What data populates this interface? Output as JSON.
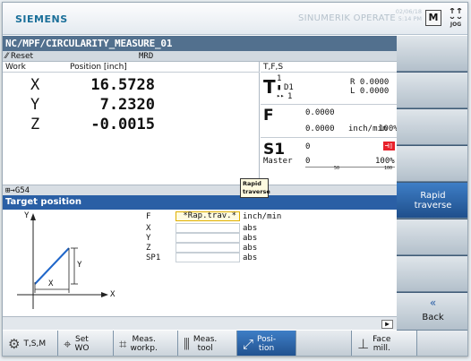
{
  "header": {
    "logo": "SIEMENS",
    "brand": "SINUMERIK OPERATE",
    "date": "02/06/18",
    "time": "5:14 PM",
    "m_label": "M",
    "jog_label": "JOG"
  },
  "path": "NC/MPF/CIRCULARITY_MEASURE_01",
  "status": {
    "reset": "Reset",
    "mrd": "MRD"
  },
  "position": {
    "col_work": "Work",
    "col_pos": "Position [inch]",
    "axes": [
      {
        "name": "X",
        "value": "16.5728"
      },
      {
        "name": "Y",
        "value": "7.2320"
      },
      {
        "name": "Z",
        "value": "-0.0015"
      }
    ]
  },
  "tfs": {
    "header": "T,F,S",
    "t_label": "T",
    "t_num": "1",
    "d_label": "D1",
    "next_tool": "1",
    "r_value": "R 0.0000",
    "l_value": "L 0.0000",
    "f_label": "F",
    "f_value1": "0.0000",
    "f_value2": "0.0000",
    "f_unit": "inch/min",
    "f_override": "100%",
    "s_label": "S1",
    "s_value1": "0",
    "s_master_label": "Master",
    "s_master_value": "0",
    "s_override": "100%",
    "s_scale_mid": "50",
    "s_scale_end": "100"
  },
  "work_offset": "G54",
  "tooltip": {
    "line1": "Rapid",
    "line2": "traverse"
  },
  "target": {
    "title": "Target position",
    "fields": [
      {
        "label": "F",
        "value": "*Rap.trav.*",
        "unit": "inch/min"
      },
      {
        "label": "X",
        "value": "",
        "unit": "abs"
      },
      {
        "label": "Y",
        "value": "",
        "unit": "abs"
      },
      {
        "label": "Z",
        "value": "",
        "unit": "abs"
      },
      {
        "label": "SP1",
        "value": "",
        "unit": "abs"
      }
    ],
    "diagram": {
      "y_axis": "Y",
      "x_axis": "X",
      "x_dim": "X",
      "y_dim": "Y"
    }
  },
  "softkeys_vertical": [
    {
      "label1": "",
      "label2": ""
    },
    {
      "label1": "",
      "label2": ""
    },
    {
      "label1": "",
      "label2": ""
    },
    {
      "label1": "",
      "label2": ""
    },
    {
      "label1": "Rapid",
      "label2": "traverse"
    },
    {
      "label1": "",
      "label2": ""
    },
    {
      "label1": "",
      "label2": ""
    },
    {
      "label1": "Back",
      "label2": ""
    }
  ],
  "softkeys_horizontal": [
    {
      "label1": "T,S,M",
      "label2": ""
    },
    {
      "label1": "Set",
      "label2": "WO"
    },
    {
      "label1": "Meas.",
      "label2": "workp."
    },
    {
      "label1": "Meas.",
      "label2": "tool"
    },
    {
      "label1": "Posi-",
      "label2": "tion"
    },
    {
      "label1": "",
      "label2": ""
    },
    {
      "label1": "Face",
      "label2": "mill."
    }
  ],
  "colors": {
    "title_bar": "#52708e",
    "selection": "#2a5fa5",
    "spindle_alarm": "#e8202a",
    "logo": "#1a6f99"
  }
}
